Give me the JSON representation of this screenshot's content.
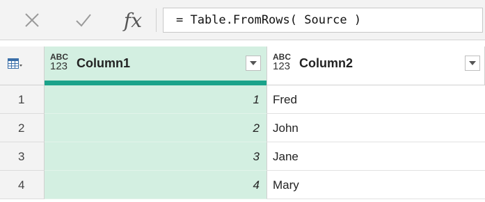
{
  "formula_bar": {
    "cancel_icon": "close-icon",
    "commit_icon": "check-icon",
    "fx_label": "fx",
    "formula": "= Table.FromRows( Source )"
  },
  "columns": [
    {
      "type_label_top": "ABC",
      "type_label_bottom": "123",
      "name": "Column1"
    },
    {
      "type_label_top": "ABC",
      "type_label_bottom": "123",
      "name": "Column2"
    }
  ],
  "rows": [
    {
      "num": "1",
      "col1": "1",
      "col2": "Fred"
    },
    {
      "num": "2",
      "col1": "2",
      "col2": "John"
    },
    {
      "num": "3",
      "col1": "3",
      "col2": "Jane"
    },
    {
      "num": "4",
      "col1": "4",
      "col2": "Mary"
    }
  ],
  "colors": {
    "selected_column_fill": "#d3efe1",
    "selected_column_band": "#1aa38a"
  }
}
